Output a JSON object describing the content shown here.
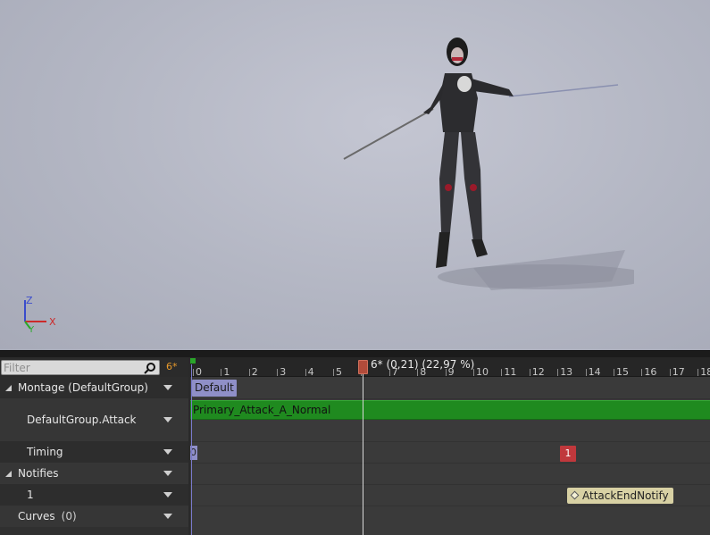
{
  "viewport": {
    "axes": {
      "z": "Z",
      "x": "X",
      "y": "Y"
    }
  },
  "filter": {
    "placeholder": "Filter",
    "frame_label": "6*"
  },
  "tracks": [
    {
      "label": "Montage (DefaultGroup)",
      "expanded": true
    },
    {
      "label": "DefaultGroup.Attack"
    },
    {
      "label": "Timing"
    },
    {
      "label": "Notifies",
      "expanded": true
    },
    {
      "label": "1"
    },
    {
      "label": "Curves",
      "count": "(0)"
    }
  ],
  "timeline": {
    "ticks": [
      "0",
      "1",
      "2",
      "3",
      "4",
      "5",
      "6",
      "7",
      "8",
      "9",
      "10",
      "11",
      "12",
      "13",
      "14",
      "15",
      "16",
      "17",
      "18"
    ],
    "playhead_label": "6* (0,21) (22,97 %)",
    "section_label": "Default",
    "segment_label": "Primary_Attack_A_Normal",
    "timing_markers": [
      "0",
      "1"
    ],
    "notify_label": "AttackEndNotify"
  },
  "colors": {
    "accent_orange": "#e89a2c",
    "section_purple": "#8f8fc8",
    "segment_green": "#1f8a1f",
    "marker_red": "#c0383c",
    "notify_tan": "#d8d1a4"
  }
}
